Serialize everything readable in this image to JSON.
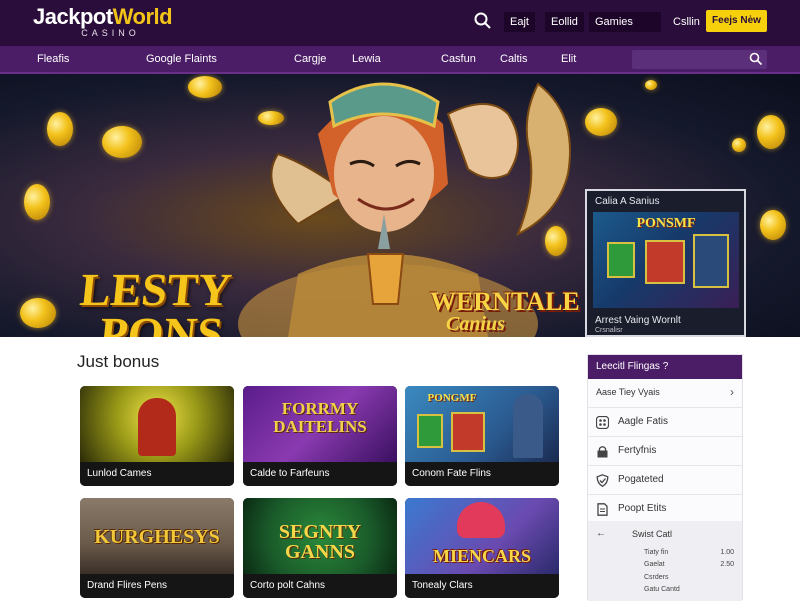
{
  "header": {
    "logo_main_dark": "Jackpot",
    "logo_main_accent": "World",
    "logo_sub": "CASINO",
    "links": [
      "Eajt",
      "Eollid",
      "Gamies",
      "Csllin"
    ],
    "join_label": "Feejs Nėw",
    "search_icon": "search-icon"
  },
  "nav": {
    "items": [
      "Fleafis",
      "Google Flaints",
      "Cargje",
      "Lewia",
      "Casfun",
      "Caltis",
      "Elit"
    ],
    "search_placeholder": "",
    "search_icon": "search-icon"
  },
  "hero": {
    "title_line1": "LESTY",
    "title_line2": "PONS",
    "brand_line1": "WERNTALE",
    "brand_line2": "Canius",
    "promo": {
      "header": "Calia A Sanius",
      "art_text": "PONSMF",
      "caption": "Arrest Vaing Wornlt",
      "caption_sub": "Crsnalisr"
    }
  },
  "section": {
    "title": "Just bonus"
  },
  "tiles": [
    {
      "label": "Lunlod Cames",
      "art_text": ""
    },
    {
      "label": "Calde to Farfeuns",
      "art_text": "FORRMY DAITELINS"
    },
    {
      "label": "Conom Fate Flins",
      "art_text": "PONGMF"
    },
    {
      "label": "Drand Flires Pens",
      "art_text": "KURGHESYS"
    },
    {
      "label": "Corto polt Cahns",
      "art_text": "SEGNTY GANNS"
    },
    {
      "label": "Tonealy Clars",
      "art_text": "MIENCARS"
    }
  ],
  "sidebar": {
    "header": "Leecitl Flingas ?",
    "first_row": "Aase Tiey Vyais",
    "rows": [
      {
        "label": "Aagle Fatis",
        "icon": "grid-icon"
      },
      {
        "label": "Fertyfnis",
        "icon": "lock-icon"
      },
      {
        "label": "Pogateted",
        "icon": "shield-icon"
      },
      {
        "label": "Poopt Etits",
        "icon": "document-icon"
      }
    ],
    "sub": {
      "title": "Swist Catl",
      "lines": [
        {
          "label": "Tiaty fin",
          "value": "1.00"
        },
        {
          "label": "Gaelat",
          "value": "2.50"
        },
        {
          "label": "Csrders",
          "value": ""
        },
        {
          "label": "Gatu Cantd",
          "value": ""
        }
      ]
    }
  }
}
